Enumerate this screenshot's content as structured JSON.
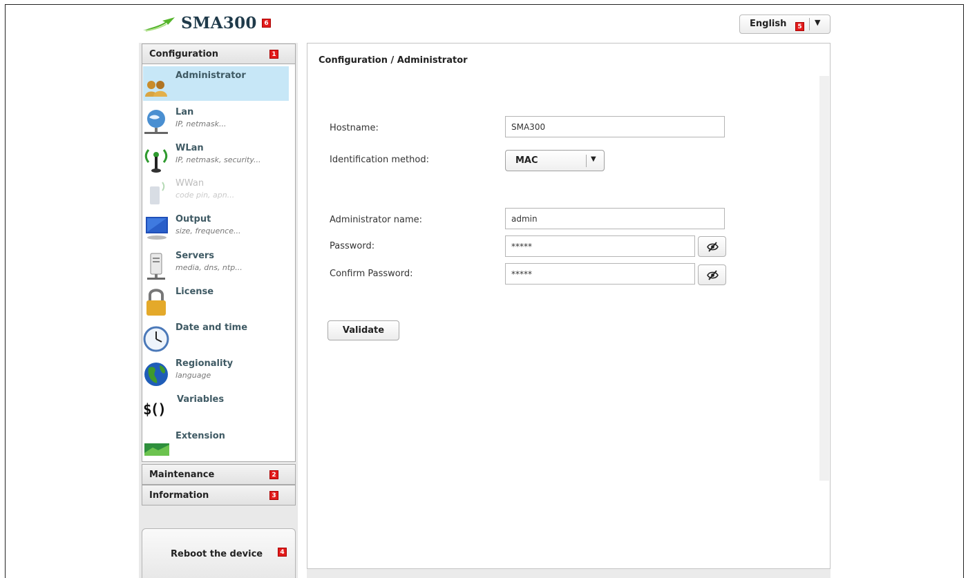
{
  "app": {
    "title": "SMA300",
    "title_marker": "6",
    "language": {
      "selected": "English",
      "marker": "5"
    }
  },
  "sidebar": {
    "configuration": {
      "label": "Configuration",
      "marker": "1"
    },
    "items": [
      {
        "title": "Administrator",
        "subtitle": "",
        "icon": "users-icon",
        "state": "active"
      },
      {
        "title": "Lan",
        "subtitle": "IP, netmask...",
        "icon": "network-globe-icon",
        "state": "normal"
      },
      {
        "title": "WLan",
        "subtitle": "IP, netmask, security...",
        "icon": "wireless-antenna-icon",
        "state": "normal"
      },
      {
        "title": "WWan",
        "subtitle": "code pin, apn...",
        "icon": "mobile-phone-icon",
        "state": "disabled"
      },
      {
        "title": "Output",
        "subtitle": "size, frequence...",
        "icon": "monitor-icon",
        "state": "normal"
      },
      {
        "title": "Servers",
        "subtitle": "media, dns, ntp...",
        "icon": "server-icon",
        "state": "normal"
      },
      {
        "title": "License",
        "subtitle": "",
        "icon": "padlock-icon",
        "state": "normal"
      },
      {
        "title": "Date and time",
        "subtitle": "",
        "icon": "clock-icon",
        "state": "normal"
      },
      {
        "title": "Regionality",
        "subtitle": "language",
        "icon": "globe-icon",
        "state": "normal"
      },
      {
        "title": "Variables",
        "subtitle": "",
        "icon": "variables-icon",
        "icon_text": "$()",
        "state": "normal"
      },
      {
        "title": "Extension",
        "subtitle": "",
        "icon": "extension-icon",
        "state": "normal"
      }
    ],
    "maintenance": {
      "label": "Maintenance",
      "marker": "2"
    },
    "information": {
      "label": "Information",
      "marker": "3"
    },
    "reboot": {
      "label": "Reboot the device",
      "marker": "4"
    }
  },
  "main": {
    "breadcrumb": "Configuration / Administrator",
    "form": {
      "hostname": {
        "label": "Hostname:",
        "value": "SMA300"
      },
      "identification": {
        "label": "Identification method:",
        "value": "MAC"
      },
      "admin_name": {
        "label": "Administrator name:",
        "value": "admin"
      },
      "password": {
        "label": "Password:",
        "value": "*****"
      },
      "confirm_password": {
        "label": "Confirm Password:",
        "value": "*****"
      },
      "validate_label": "Validate"
    }
  },
  "colors": {
    "active_item": "#c7e7f7",
    "marker": "#e21b1b",
    "brand_text": "#1f3a4a"
  }
}
